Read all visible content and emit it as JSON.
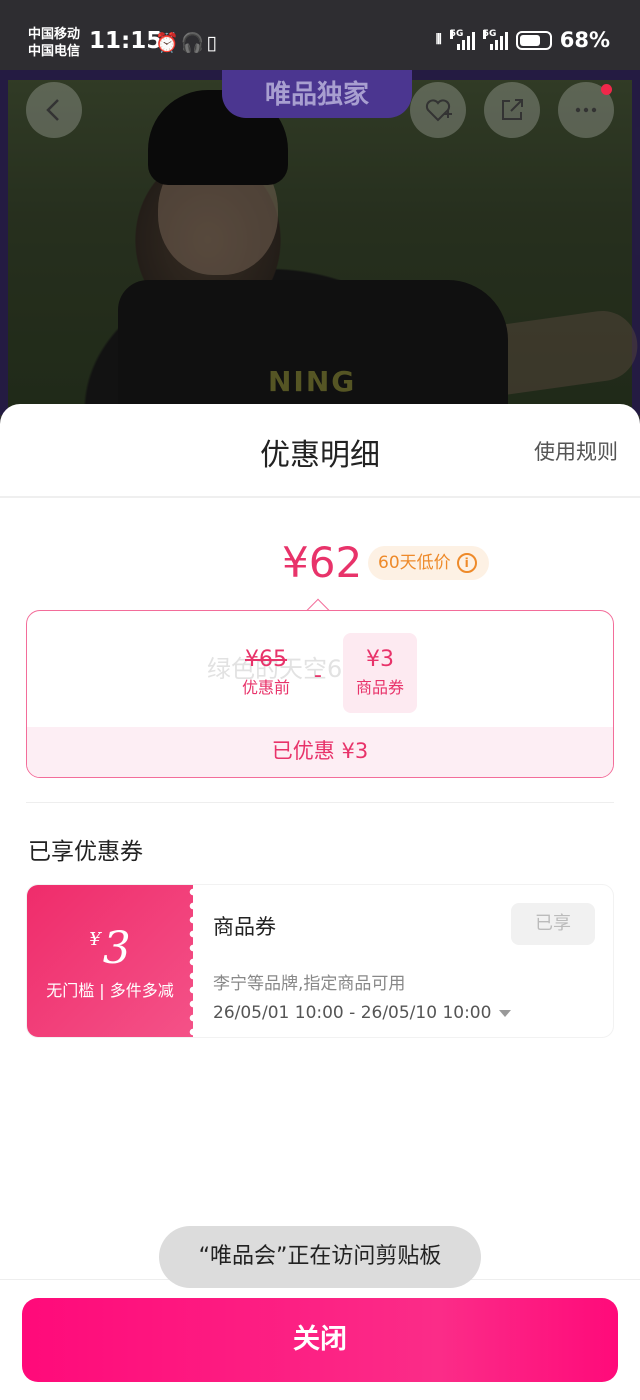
{
  "status_bar": {
    "carrier_1": "中国移动",
    "carrier_2": "中国电信",
    "time": "11:15",
    "icons_left": [
      "alarm-icon",
      "headphones-icon",
      "battery-saver-icon"
    ],
    "icons_right": [
      "vibrate-icon",
      "signal-5g-icon",
      "signal-5g-icon",
      "battery-icon"
    ],
    "signal_label_1": "5G",
    "signal_label_2": "5G",
    "battery_percent": "68%"
  },
  "hero": {
    "exclusive_label": "唯品独家",
    "print_text": "NING",
    "buttons": [
      "back-icon",
      "favorite-add-icon",
      "share-icon",
      "more-icon"
    ]
  },
  "sheet": {
    "title": "优惠明细",
    "rules_link": "使用规则",
    "final_price": "¥62",
    "low_price_badge": "60天低价",
    "info_icon_glyph": "i",
    "calculation": {
      "original_price": "¥65",
      "original_label": "优惠前",
      "minus": "-",
      "coupon_amount": "¥3",
      "coupon_label": "商品券",
      "saved_text": "已优惠 ¥3",
      "watermark": "绿色的天空666"
    },
    "section_title": "已享优惠券",
    "coupon": {
      "currency": "¥",
      "value": "3",
      "condition": "无门槛 | 多件多减",
      "name": "商品券",
      "status": "已享",
      "description": "李宁等品牌,指定商品可用",
      "validity": "26/05/01 10:00 - 26/05/10 10:00"
    },
    "toast": "“唯品会”正在访问剪贴板",
    "close_button": "关闭"
  },
  "colors": {
    "accent": "#e8336a",
    "button": "#ff0a7a",
    "low_badge_bg": "#fdf1e4",
    "low_badge_text": "#ee8a2a"
  }
}
